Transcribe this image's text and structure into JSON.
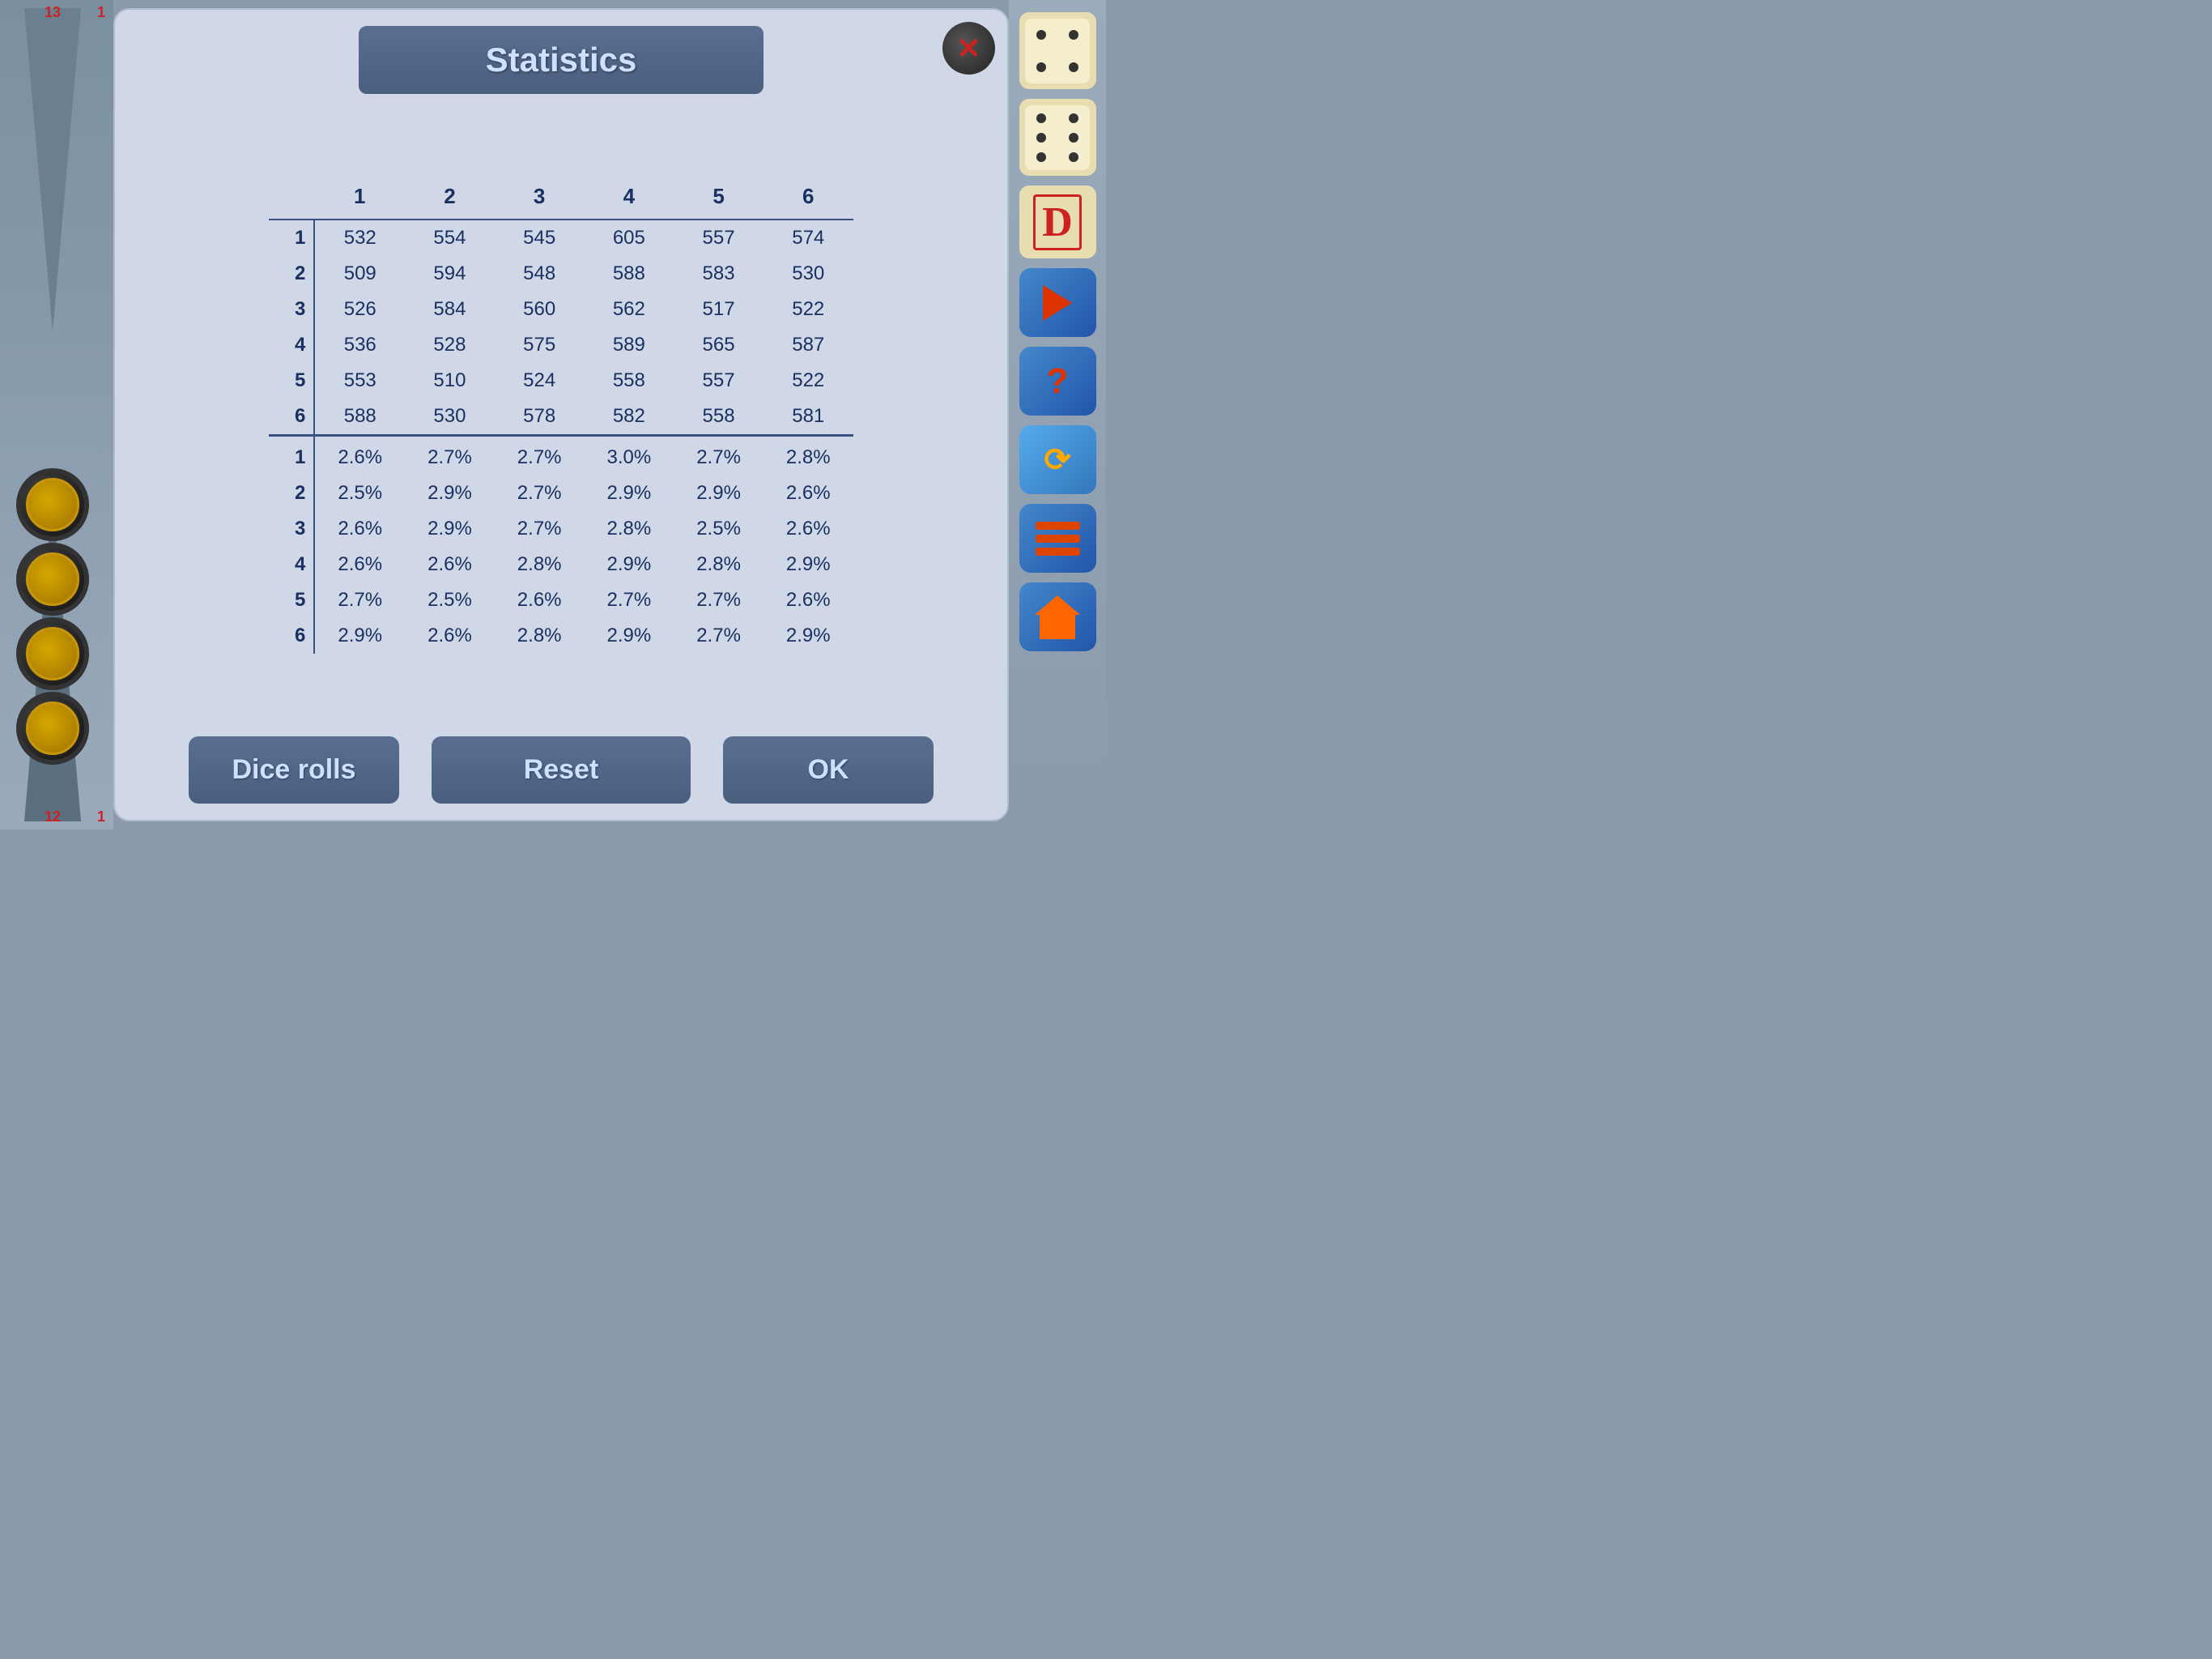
{
  "board": {
    "num_top_left": "13",
    "num_top_right": "1",
    "num_bottom_left": "12",
    "num_bottom_right": "1"
  },
  "dialog": {
    "title": "Statistics",
    "close_label": "×",
    "table": {
      "col_headers": [
        "",
        "1",
        "2",
        "3",
        "4",
        "5",
        "6"
      ],
      "counts": {
        "row1": [
          "1",
          "532",
          "554",
          "545",
          "605",
          "557",
          "574"
        ],
        "row2": [
          "2",
          "509",
          "594",
          "548",
          "588",
          "583",
          "530"
        ],
        "row3": [
          "3",
          "526",
          "584",
          "560",
          "562",
          "517",
          "522"
        ],
        "row4": [
          "4",
          "536",
          "528",
          "575",
          "589",
          "565",
          "587"
        ],
        "row5": [
          "5",
          "553",
          "510",
          "524",
          "558",
          "557",
          "522"
        ],
        "row6": [
          "6",
          "588",
          "530",
          "578",
          "582",
          "558",
          "581"
        ]
      },
      "percents": {
        "row1": [
          "1",
          "2.6%",
          "2.7%",
          "2.7%",
          "3.0%",
          "2.7%",
          "2.8%"
        ],
        "row2": [
          "2",
          "2.5%",
          "2.9%",
          "2.7%",
          "2.9%",
          "2.9%",
          "2.6%"
        ],
        "row3": [
          "3",
          "2.6%",
          "2.9%",
          "2.7%",
          "2.8%",
          "2.5%",
          "2.6%"
        ],
        "row4": [
          "4",
          "2.6%",
          "2.6%",
          "2.8%",
          "2.9%",
          "2.8%",
          "2.9%"
        ],
        "row5": [
          "5",
          "2.7%",
          "2.5%",
          "2.6%",
          "2.7%",
          "2.7%",
          "2.6%"
        ],
        "row6": [
          "6",
          "2.9%",
          "2.6%",
          "2.8%",
          "2.9%",
          "2.7%",
          "2.9%"
        ]
      }
    },
    "buttons": {
      "dice_rolls": "Dice rolls",
      "reset": "Reset",
      "ok": "OK"
    }
  }
}
